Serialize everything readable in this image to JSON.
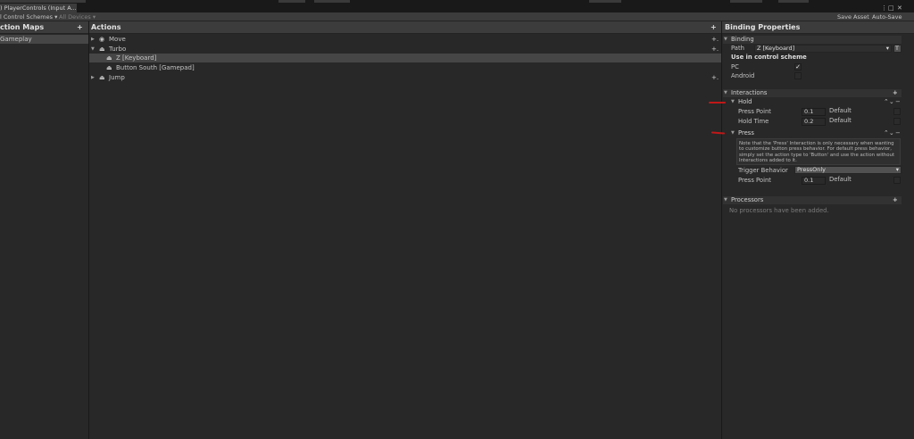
{
  "window": {
    "tab_title": ") PlayerControls (Input A..."
  },
  "toolbar": {
    "control_schemes": "l Control Schemes",
    "all_devices": "All Devices",
    "save_asset": "Save Asset",
    "auto_save": "Auto-Save"
  },
  "action_maps": {
    "title": "ction Maps",
    "items": [
      {
        "label": "Gameplay",
        "selected": true
      }
    ]
  },
  "actions": {
    "title": "Actions",
    "items": [
      {
        "label": "Move",
        "icon": "target-icon",
        "expanded": false
      },
      {
        "label": "Turbo",
        "icon": "person-icon",
        "expanded": true
      },
      {
        "label": "Z [Keyboard]",
        "icon": "person-icon",
        "binding": true,
        "selected": true
      },
      {
        "label": "Button South [Gamepad]",
        "icon": "person-icon",
        "binding": true
      },
      {
        "label": "Jump",
        "icon": "person-icon",
        "expanded": false
      }
    ]
  },
  "binding_properties": {
    "title": "Binding Properties",
    "binding_section": "Binding",
    "path_label": "Path",
    "path_value": "Z [Keyboard]",
    "t_button": "T",
    "use_in_scheme": "Use in control scheme",
    "schemes": [
      {
        "label": "PC",
        "checked": true
      },
      {
        "label": "Android",
        "checked": false
      }
    ],
    "interactions_section": "Interactions",
    "hold": {
      "title": "Hold",
      "press_point_label": "Press Point",
      "press_point_value": "0.1",
      "hold_time_label": "Hold Time",
      "hold_time_value": "0.2",
      "default_label": "Default"
    },
    "press": {
      "title": "Press",
      "note": "Note that the 'Press' Interaction is only necessary when wanting to customize button press behavior. For default press behavior, simply set the action type to 'Button' and use the action without Interactions added to it.",
      "trigger_behavior_label": "Trigger Behavior",
      "trigger_behavior_value": "PressOnly",
      "press_point_label": "Press Point",
      "press_point_value": "0.1",
      "default_label": "Default"
    },
    "processors_section": "Processors",
    "processors_empty": "No processors have been added."
  },
  "colors": {
    "background": "#282828",
    "header": "#3c3c3c",
    "selection": "#464646",
    "annotation_red": "#c01818"
  }
}
